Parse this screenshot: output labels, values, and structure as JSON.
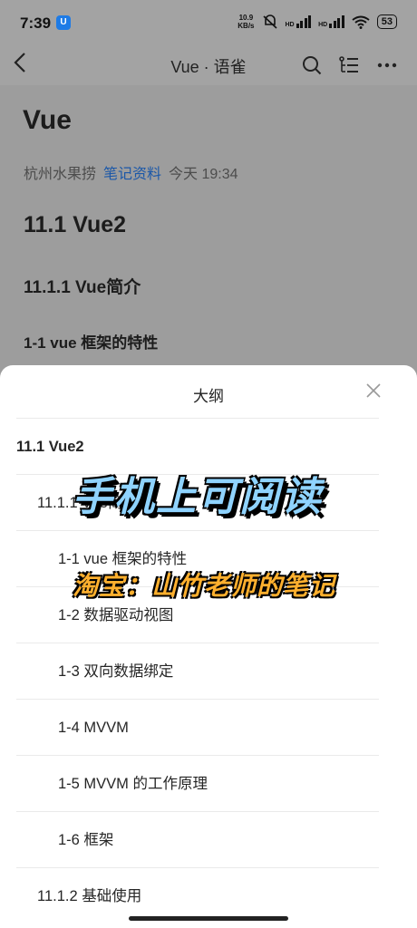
{
  "status_bar": {
    "time": "7:39",
    "app_badge": "U",
    "net_speed_value": "10.9",
    "net_speed_unit": "KB/s",
    "signal_label_1": "HD",
    "signal_label_2": "HD",
    "battery": "53"
  },
  "nav": {
    "title": "Vue · 语雀",
    "back_icon": "chevron-left-icon",
    "search_icon": "search-icon",
    "outline_icon": "outline-list-icon",
    "more_icon": "more-horizontal-icon"
  },
  "doc": {
    "title": "Vue",
    "author": "杭州水果捞",
    "folder": "笔记资料",
    "time": "今天 19:34",
    "h1": "11.1 Vue2",
    "h2": "11.1.1 Vue简介",
    "h3": "1-1 vue 框架的特性"
  },
  "outline": {
    "title": "大纲",
    "close_icon": "close-icon",
    "items": [
      {
        "level": 1,
        "label": "11.1 Vue2"
      },
      {
        "level": 2,
        "label": "11.1.1 Vue简介"
      },
      {
        "level": 3,
        "label": "1-1 vue 框架的特性"
      },
      {
        "level": 3,
        "label": "1-2 数据驱动视图"
      },
      {
        "level": 3,
        "label": "1-3 双向数据绑定"
      },
      {
        "level": 3,
        "label": "1-4 MVVM"
      },
      {
        "level": 3,
        "label": "1-5 MVVM 的工作原理"
      },
      {
        "level": 3,
        "label": "1-6 框架"
      },
      {
        "level": 2,
        "label": "11.1.2 基础使用"
      }
    ]
  },
  "overlay": {
    "title": "手机上可阅读",
    "subtitle": "淘宝：山竹老师的笔记"
  },
  "colors": {
    "link": "#1c58a8",
    "overlay_title": "#8fd3ff",
    "overlay_sub": "#ffb02e"
  }
}
